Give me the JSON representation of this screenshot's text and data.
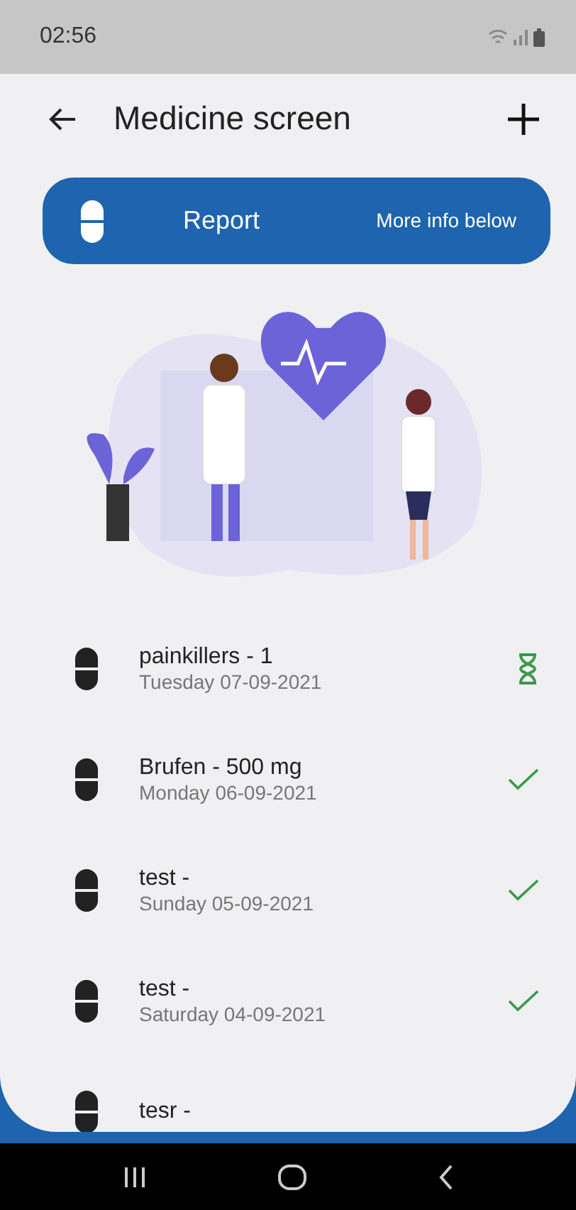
{
  "status_bar": {
    "time": "02:56"
  },
  "app_bar": {
    "title": "Medicine screen"
  },
  "report_banner": {
    "title": "Report",
    "subtitle": "More info below"
  },
  "medicines": [
    {
      "name": "painkillers - 1",
      "date": "Tuesday 07-09-2021",
      "taken": false
    },
    {
      "name": "Brufen - 500 mg",
      "date": "Monday 06-09-2021",
      "taken": true
    },
    {
      "name": "test -",
      "date": "Sunday 05-09-2021",
      "taken": true
    },
    {
      "name": "test -",
      "date": "Saturday 04-09-2021",
      "taken": true
    },
    {
      "name": "tesr -"
    }
  ]
}
